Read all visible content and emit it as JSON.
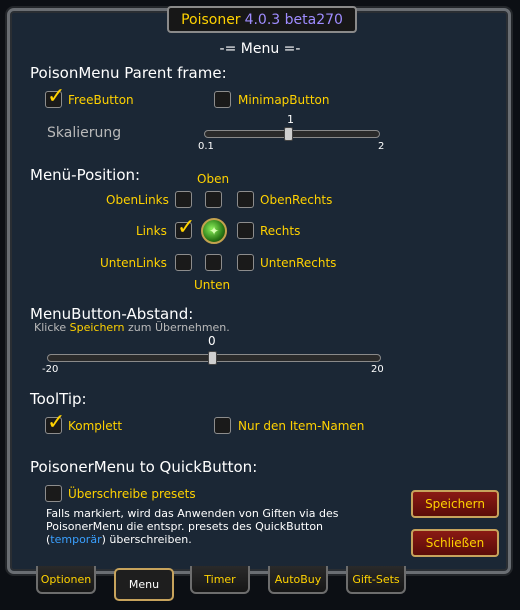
{
  "window": {
    "title_name": "Poisoner",
    "title_version": "4.0.3 beta270"
  },
  "menu_heading": "-= Menu =-",
  "parent_frame": {
    "title": "PoisonMenu Parent frame:",
    "free_button": {
      "label": "FreeButton",
      "checked": true
    },
    "minimap_button": {
      "label": "MinimapButton",
      "checked": false
    },
    "scale_label": "Skalierung",
    "scale": {
      "value": "1",
      "min": "0.1",
      "max": "2"
    }
  },
  "menu_position": {
    "title": "Menü-Position:",
    "oben": "Oben",
    "unten": "Unten",
    "oben_links": "ObenLinks",
    "oben_rechts": "ObenRechts",
    "links": "Links",
    "rechts": "Rechts",
    "unten_links": "UntenLinks",
    "unten_rechts": "UntenRechts",
    "selected": "Links"
  },
  "button_distance": {
    "title": "MenuButton-Abstand:",
    "hint_pre": "Klicke",
    "hint_action": "Speichern",
    "hint_post": "zum Übernehmen.",
    "value": "0",
    "min": "-20",
    "max": "20"
  },
  "tooltip": {
    "title": "ToolTip:",
    "complete": {
      "label": "Komplett",
      "checked": true
    },
    "item_names": {
      "label": "Nur den Item-Namen",
      "checked": false
    }
  },
  "quickbutton": {
    "title": "PoisonerMenu to QuickButton:",
    "overwrite": {
      "label": "Überschreibe presets",
      "checked": false
    },
    "note_line1": "Falls markiert, wird das Anwenden von Giften via des",
    "note_line2": "PoisonerMenu die entspr. presets des QuickButton",
    "note_paren_open": "(",
    "note_temp": "temporär",
    "note_line3_rest": ") überschreiben."
  },
  "buttons": {
    "save": "Speichern",
    "close": "Schließen"
  },
  "tabs": [
    {
      "label": "Optionen",
      "active": false
    },
    {
      "label": "Menu",
      "active": true
    },
    {
      "label": "Timer",
      "active": false
    },
    {
      "label": "AutoBuy",
      "active": false
    },
    {
      "label": "Gift-Sets",
      "active": false
    }
  ],
  "colors": {
    "gold": "#ffd200",
    "panel": "#1b2735",
    "accent_blue": "#3aa0ff",
    "button_red": "#8a1a14"
  }
}
